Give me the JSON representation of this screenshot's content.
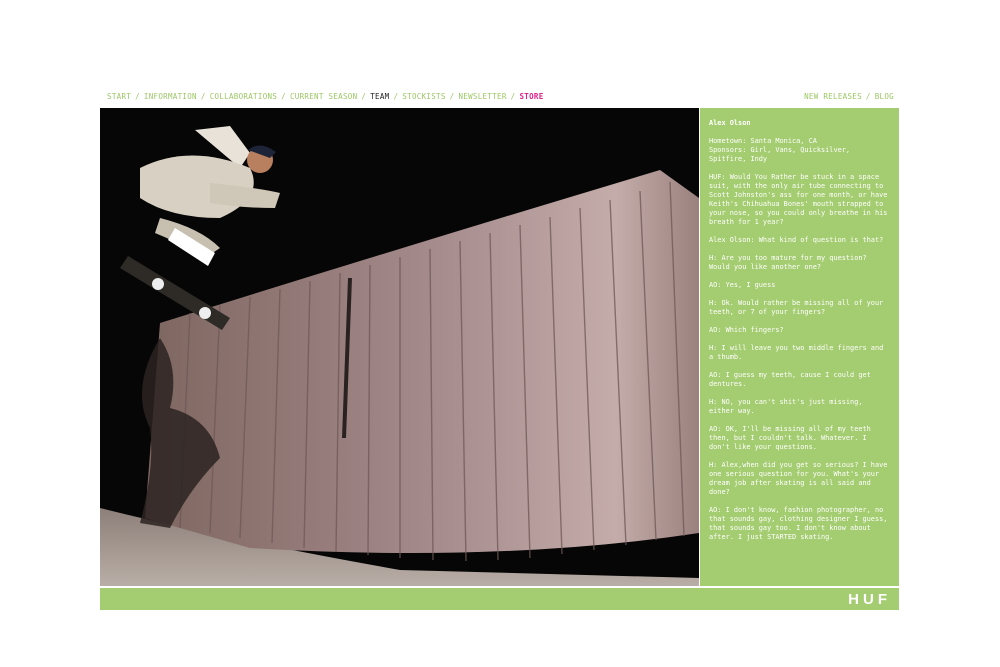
{
  "nav": {
    "left": [
      {
        "label": "START"
      },
      {
        "label": "INFORMATION"
      },
      {
        "label": "COLLABORATIONS"
      },
      {
        "label": "CURRENT SEASON"
      },
      {
        "label": "TEAM"
      },
      {
        "label": "STOCKISTS"
      },
      {
        "label": "NEWSLETTER"
      },
      {
        "label": "STORE"
      }
    ],
    "right": [
      {
        "label": "NEW RELEASES"
      },
      {
        "label": "BLOG"
      }
    ],
    "separator": "/",
    "active": "TEAM",
    "highlight": "STORE"
  },
  "colors": {
    "accent_green": "#a4cc70",
    "nav_green": "#9cc766",
    "store_pink": "#e0218a",
    "active_dark": "#222222"
  },
  "profile": {
    "name": "Alex Olson",
    "hometown": "Hometown: Santa Monica, CA",
    "sponsors": "Sponsors: Girl, Vans, Quicksilver, Spitfire, Indy",
    "qa": [
      "HUF: Would You Rather be stuck in a space suit, with the only air tube connecting to Scott Johnston's ass for one month, or have Keith's Chihuahua Bones' mouth strapped to your nose, so you could only breathe in his breath for 1 year?",
      "Alex Olson: What kind of question is that?",
      "H: Are you too mature for my question? Would you like another one?",
      "AO: Yes, I guess",
      "H: Ok. Would rather be missing all of your teeth, or 7 of your fingers?",
      "AO: Which fingers?",
      "H: I will leave you two middle fingers and a thumb.",
      "AO: I guess my teeth, cause I could get dentures.",
      "H: NO, you can't shit's just missing, either way.",
      "AO: OK, I'll be missing all of my teeth then, but I couldn't talk. Whatever. I don't like your questions.",
      "H: Alex,when did you get so serious? I have one serious question for you. What's your dream job after skating is all said and done?",
      "AO: I don't know, fashion photographer, no that sounds gay, clothing designer I guess, that sounds gay too. I don't know about after. I just STARTED skating."
    ]
  },
  "footer": {
    "logo": "HUF"
  },
  "photo": {
    "icon": "skateboarder-photo"
  }
}
